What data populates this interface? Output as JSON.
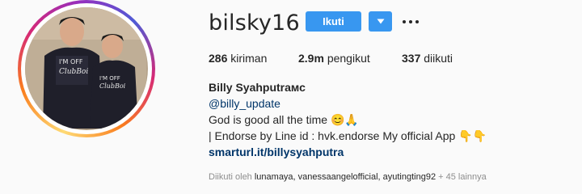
{
  "profile": {
    "username": "bilsky16",
    "follow_label": "Ikuti",
    "verified_icon": "verified-badge-icon",
    "dropdown_icon": "caret-down-icon",
    "more_icon": "more-options-icon"
  },
  "stats": {
    "posts_count": "286",
    "posts_label": "kiriman",
    "followers_count": "2.9m",
    "followers_label": "pengikut",
    "following_count": "337",
    "following_label": "diikuti"
  },
  "bio": {
    "full_name": "Billy Syahputraмс",
    "handle": "@billy_update",
    "line1": "God is good all the time 😊🙏",
    "line2": "| Endorse by Line id : hvk.endorse My official App 👇👇",
    "link": "smarturl.it/billysyahputra"
  },
  "followed_by": {
    "prefix": "Diikuti oleh ",
    "names": "lunamaya, vanessaangelofficial, ayutingting92",
    "suffix": " + 45 lainnya"
  },
  "colors": {
    "accent": "#3897f0",
    "link": "#003569",
    "muted": "#8e8e8e"
  }
}
